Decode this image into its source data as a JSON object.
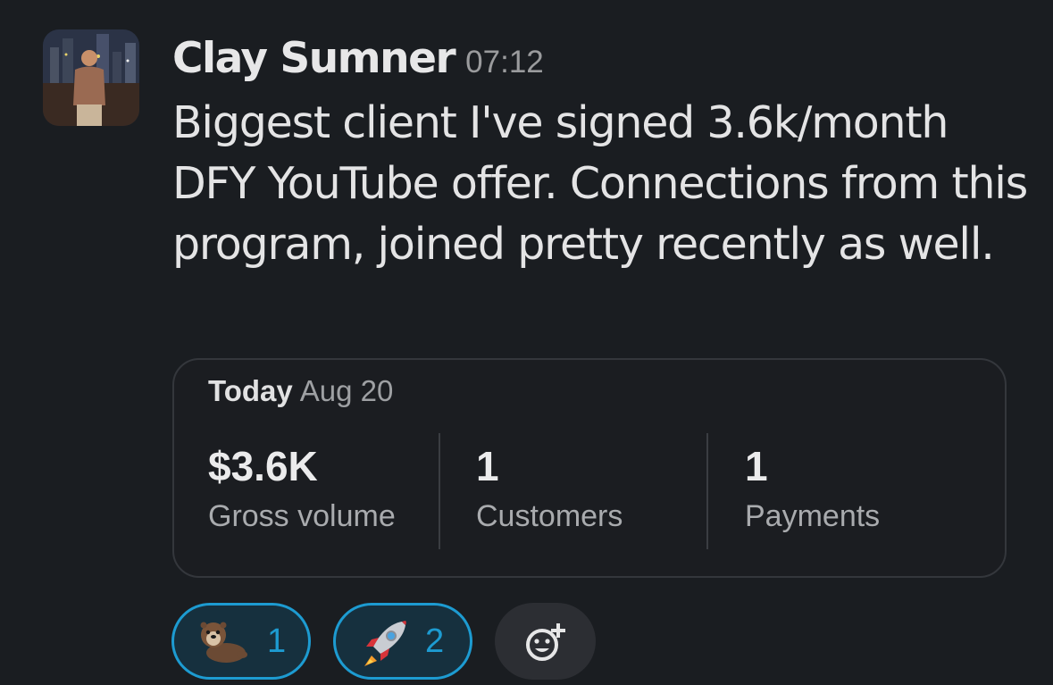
{
  "message": {
    "author": "Clay Sumner",
    "time": "07:12",
    "text": "Biggest client I've signed 3.6k/month DFY YouTube offer. Connections from this program, joined pretty recently as well."
  },
  "card": {
    "today_label": "Today",
    "date": "Aug 20",
    "stats": [
      {
        "value": "$3.6K",
        "label": "Gross volume"
      },
      {
        "value": "1",
        "label": "Customers"
      },
      {
        "value": "1",
        "label": "Payments"
      }
    ]
  },
  "reactions": [
    {
      "emoji": "otter",
      "count": "1"
    },
    {
      "emoji": "rocket",
      "count": "2"
    }
  ],
  "icons": {
    "add_reaction": "add-reaction-icon"
  },
  "colors": {
    "background": "#1a1d21",
    "reaction_accent": "#1d9bd1",
    "reaction_fill": "#16303e"
  }
}
